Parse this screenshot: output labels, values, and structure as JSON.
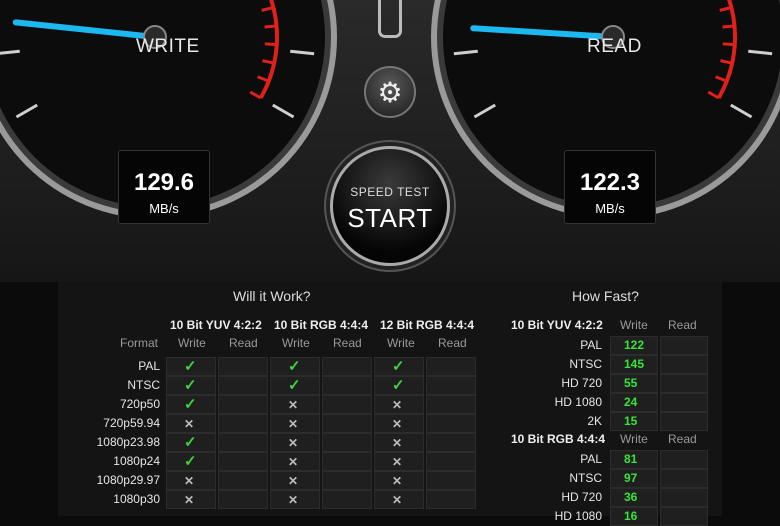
{
  "write_gauge": {
    "label": "WRITE",
    "value": "129.6",
    "unit": "MB/s",
    "needle_fraction": 0.15
  },
  "read_gauge": {
    "label": "READ",
    "value": "122.3",
    "unit": "MB/s",
    "needle_fraction": 0.14
  },
  "start_button": {
    "line1": "SPEED TEST",
    "line2": "START"
  },
  "settings_icon": "gear-icon",
  "will_it_work": {
    "title": "Will it Work?",
    "format_label": "Format",
    "groups": [
      "10 Bit YUV 4:2:2",
      "10 Bit RGB 4:4:4",
      "12 Bit RGB 4:4:4"
    ],
    "sub_write": "Write",
    "sub_read": "Read",
    "rows": [
      {
        "format": "PAL",
        "marks": [
          "ok",
          "ok",
          "ok"
        ]
      },
      {
        "format": "NTSC",
        "marks": [
          "ok",
          "ok",
          "ok"
        ]
      },
      {
        "format": "720p50",
        "marks": [
          "ok",
          "no",
          "no"
        ]
      },
      {
        "format": "720p59.94",
        "marks": [
          "no",
          "no",
          "no"
        ]
      },
      {
        "format": "1080p23.98",
        "marks": [
          "ok",
          "no",
          "no"
        ]
      },
      {
        "format": "1080p24",
        "marks": [
          "ok",
          "no",
          "no"
        ]
      },
      {
        "format": "1080p29.97",
        "marks": [
          "no",
          "no",
          "no"
        ]
      },
      {
        "format": "1080p30",
        "marks": [
          "no",
          "no",
          "no"
        ]
      }
    ]
  },
  "how_fast": {
    "title": "How Fast?",
    "sub_write": "Write",
    "sub_read": "Read",
    "sections": [
      {
        "header": "10 Bit YUV 4:2:2",
        "rows": [
          {
            "format": "PAL",
            "write": "122"
          },
          {
            "format": "NTSC",
            "write": "145"
          },
          {
            "format": "HD 720",
            "write": "55"
          },
          {
            "format": "HD 1080",
            "write": "24"
          },
          {
            "format": "2K",
            "write": "15"
          }
        ]
      },
      {
        "header": "10 Bit RGB 4:4:4",
        "rows": [
          {
            "format": "PAL",
            "write": "81"
          },
          {
            "format": "NTSC",
            "write": "97"
          },
          {
            "format": "HD 720",
            "write": "36"
          },
          {
            "format": "HD 1080",
            "write": "16"
          }
        ]
      }
    ]
  },
  "colors": {
    "needle": "#1cb8f0",
    "ok": "#3fd23f",
    "speed": "#39e339",
    "redzone": "#e0201a"
  }
}
